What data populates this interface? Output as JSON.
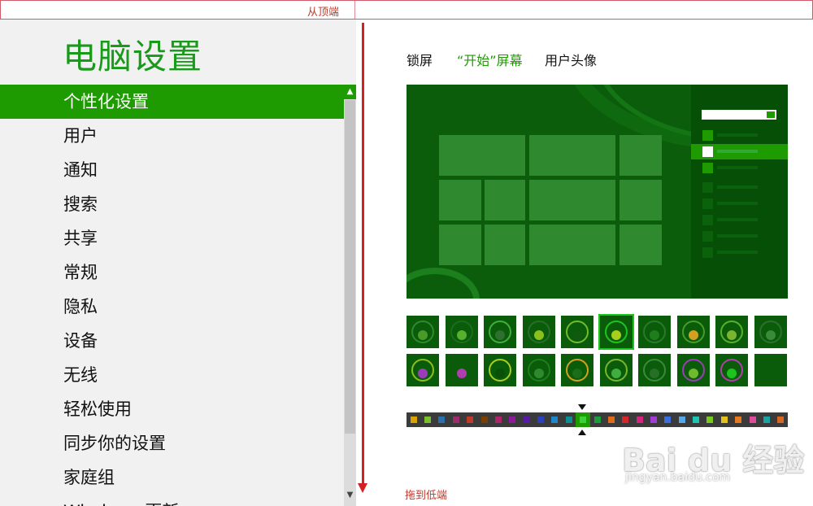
{
  "annotations": {
    "top": "从顶端",
    "bottom": "拖到低端"
  },
  "app": {
    "title": "电脑设置"
  },
  "nav": {
    "items": [
      {
        "label": "个性化设置",
        "active": true
      },
      {
        "label": "用户"
      },
      {
        "label": "通知"
      },
      {
        "label": "搜索"
      },
      {
        "label": "共享"
      },
      {
        "label": "常规"
      },
      {
        "label": "隐私"
      },
      {
        "label": "设备"
      },
      {
        "label": "无线"
      },
      {
        "label": "轻松使用"
      },
      {
        "label": "同步你的设置"
      },
      {
        "label": "家庭组"
      },
      {
        "label": "Windows 更新"
      }
    ]
  },
  "tabs": [
    {
      "label": "锁屏"
    },
    {
      "label": "“开始”屏幕",
      "active": true
    },
    {
      "label": "用户头像"
    }
  ],
  "colors": {
    "accent": "#1e9b00",
    "swatches": [
      "#d9a400",
      "#7bbf2a",
      "#2a6fb0",
      "#9b2d6b",
      "#c0392b",
      "#7a3e00",
      "#b0246a",
      "#8e1a9b",
      "#5a1aa8",
      "#2b3fbf",
      "#1f86c9",
      "#0c8f8f",
      "#1e9b00",
      "#1a9e3a",
      "#e0691a",
      "#d7262a",
      "#d4247f",
      "#a23bd6",
      "#3b6fe0",
      "#56a7e8",
      "#1ec4b0",
      "#79c91e",
      "#e0c21a",
      "#e8791e",
      "#e04a9a",
      "#19a3a3",
      "#d9661e"
    ],
    "selected_swatch_index": 12
  },
  "watermark": {
    "logo": "Bai du 经验",
    "url": "jingyan.baidu.com"
  },
  "icons": [
    "chevron-up-icon",
    "chevron-down-icon",
    "arrow-down-icon",
    "caret-up-icon",
    "caret-down-icon"
  ]
}
